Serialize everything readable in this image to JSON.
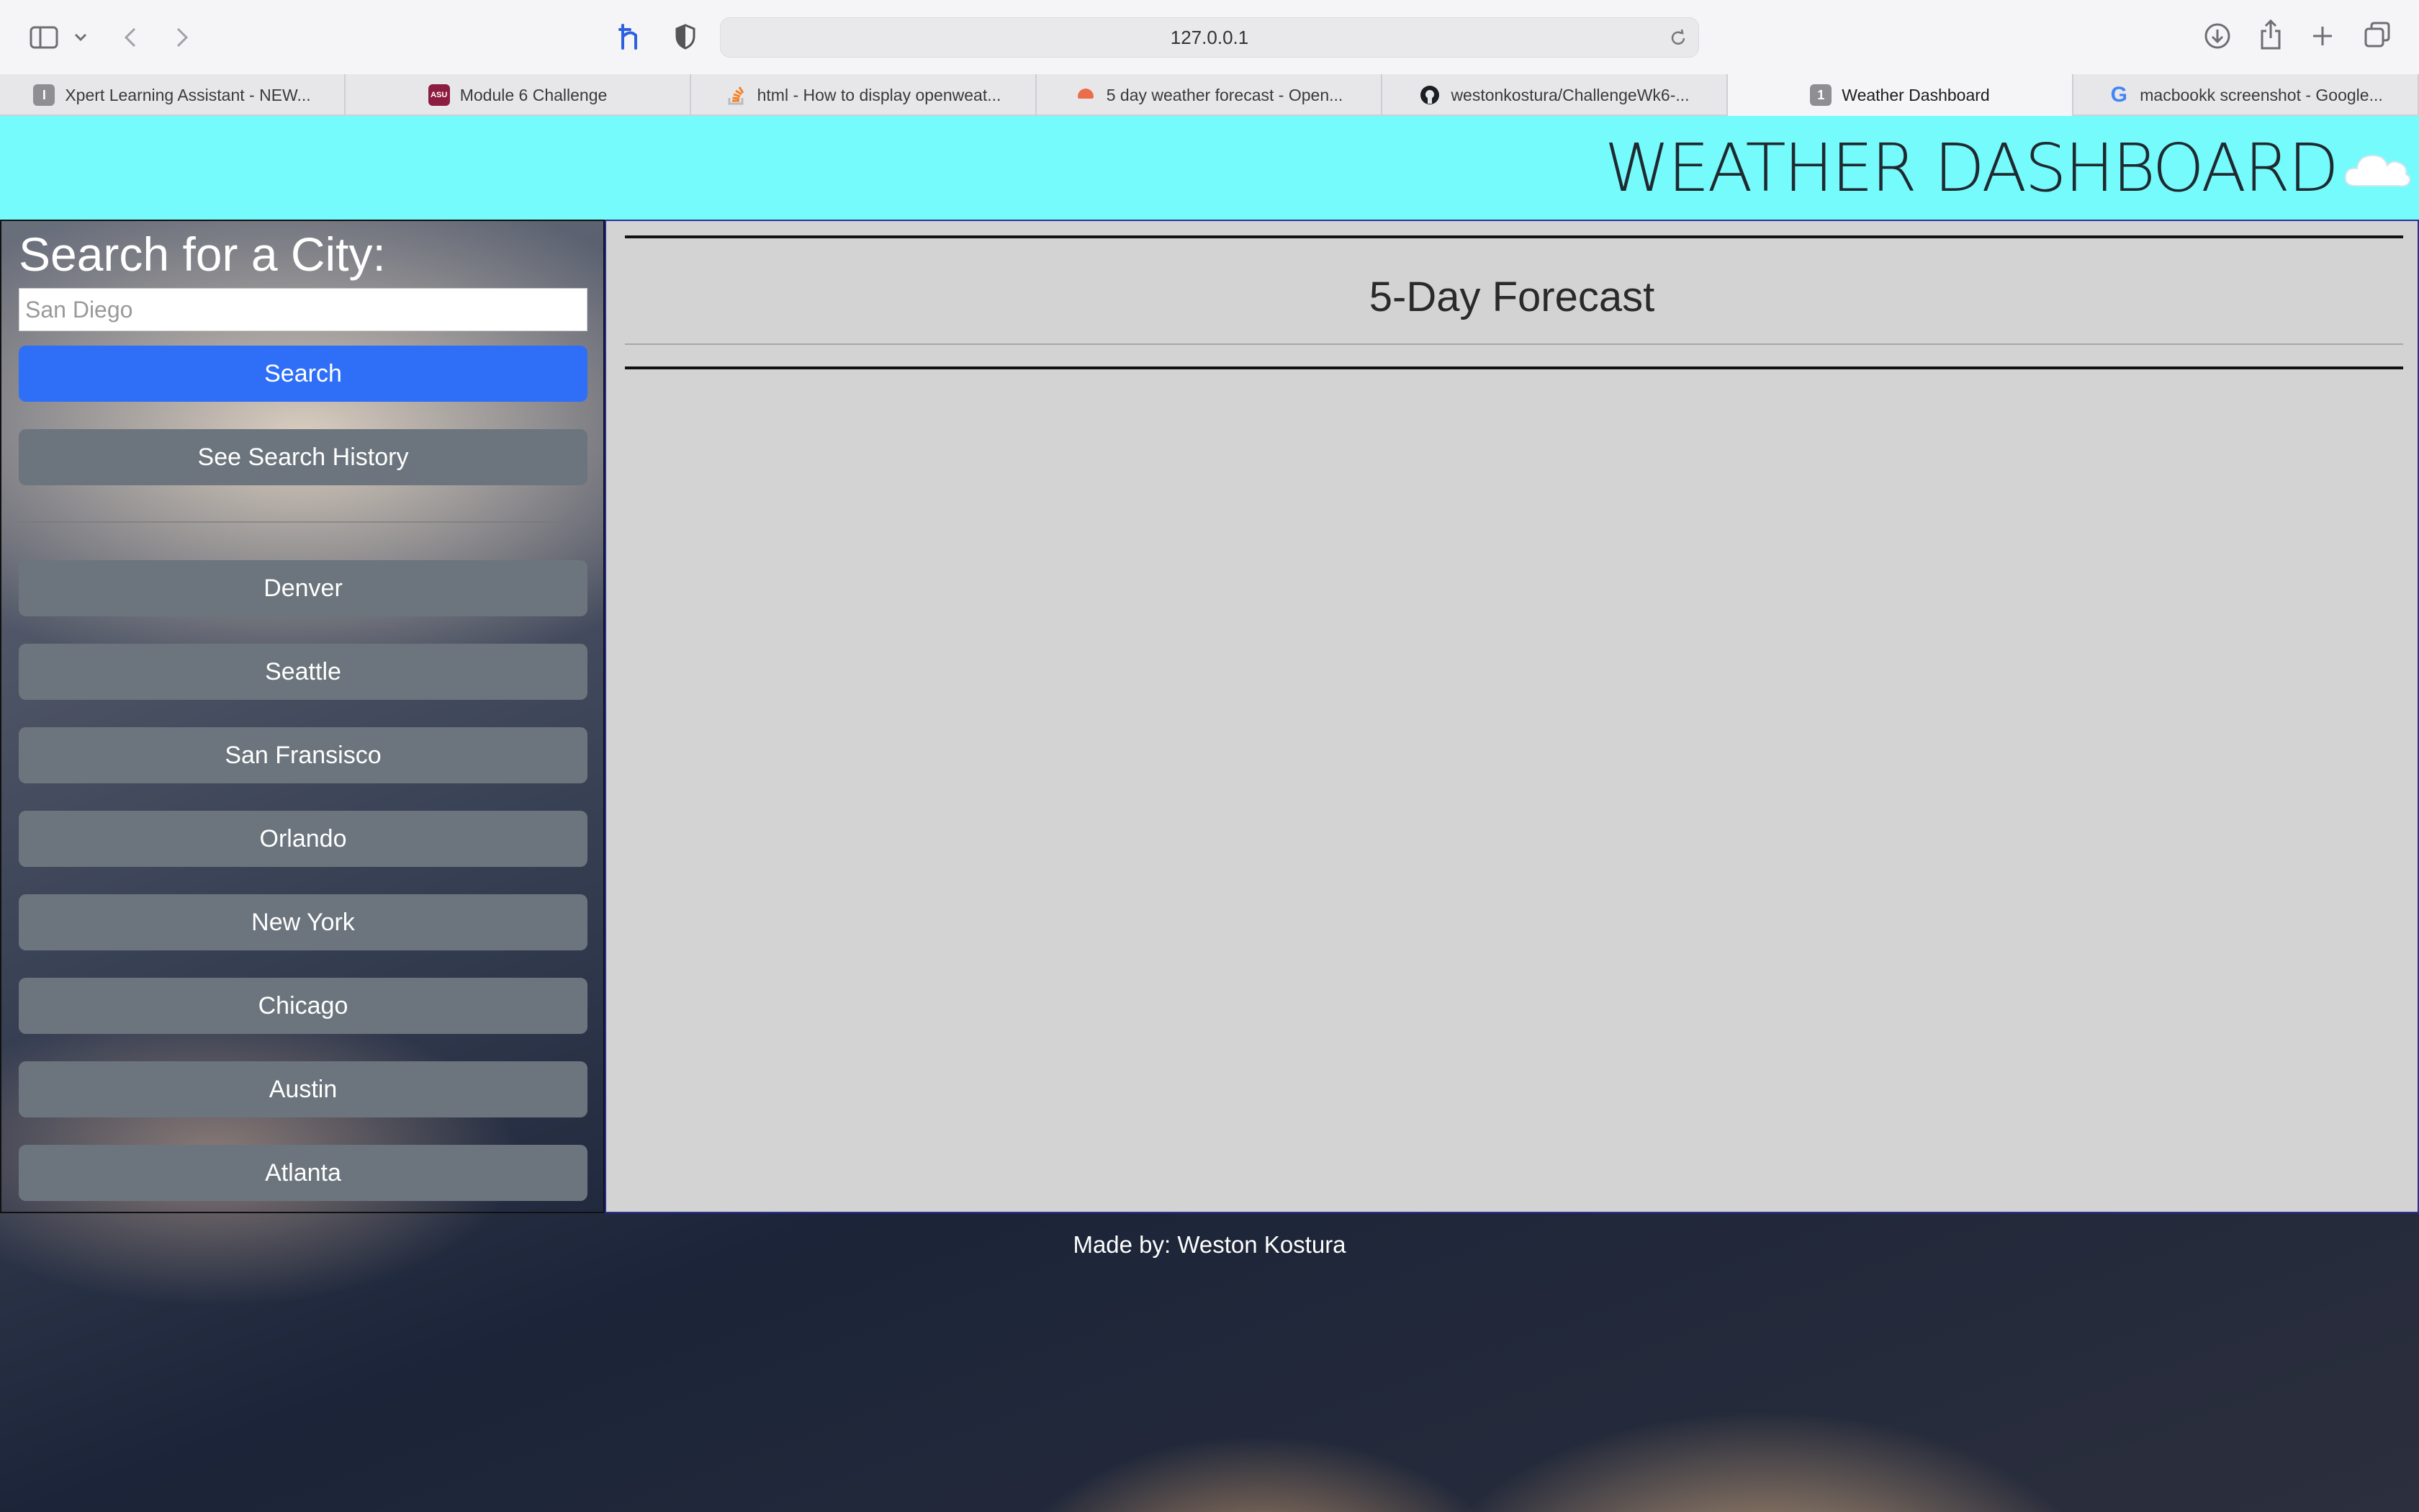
{
  "browser": {
    "url": "127.0.0.1",
    "tabs": [
      {
        "title": "Xpert Learning Assistant - NEW...",
        "favicon": "I",
        "favicon_color": "#8e8e93"
      },
      {
        "title": "Module 6 Challenge",
        "favicon": "ASU",
        "favicon_color": "#8c1d40"
      },
      {
        "title": "html - How to display openweat...",
        "favicon": "stack-overflow-icon",
        "favicon_color": "#f48024"
      },
      {
        "title": "5 day weather forecast - Open...",
        "favicon": "openweather-icon",
        "favicon_color": "#eb6e4b"
      },
      {
        "title": "westonkostura/ChallengeWk6-...",
        "favicon": "github-icon",
        "favicon_color": "#1b1f23"
      },
      {
        "title": "Weather Dashboard",
        "favicon": "1",
        "favicon_color": "#8e8e93",
        "active": true
      },
      {
        "title": "macbookk screenshot - Google...",
        "favicon": "google-icon",
        "favicon_color": "#4285f4"
      }
    ]
  },
  "header": {
    "title": "WEATHER DASHBOARD",
    "icon": "cloud-icon",
    "background_color": "#76fbfd"
  },
  "sidebar": {
    "title": "Search for a City:",
    "search_placeholder": "San Diego",
    "search_button": "Search",
    "history_button": "See Search History",
    "cities": [
      "Denver",
      "Seattle",
      "San Fransisco",
      "Orlando",
      "New York",
      "Chicago",
      "Austin",
      "Atlanta"
    ],
    "primary_color": "#2f6ff8",
    "secondary_color": "#6c757d"
  },
  "main": {
    "forecast_title": "5-Day Forecast",
    "background_color": "#d3d3d3"
  },
  "footer": {
    "text": "Made by: Weston Kostura"
  }
}
